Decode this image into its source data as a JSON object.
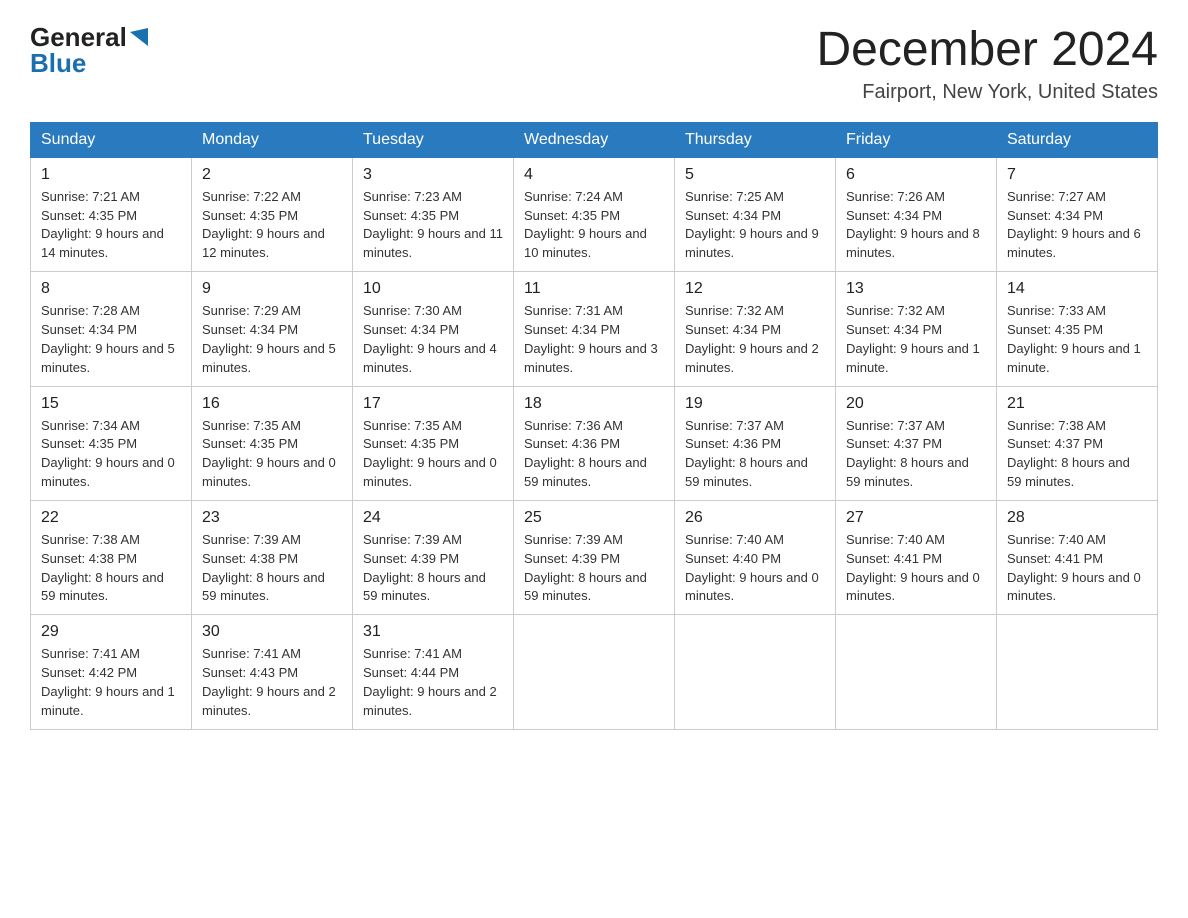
{
  "header": {
    "logo_general": "General",
    "logo_blue": "Blue",
    "month_title": "December 2024",
    "location": "Fairport, New York, United States"
  },
  "weekdays": [
    "Sunday",
    "Monday",
    "Tuesday",
    "Wednesday",
    "Thursday",
    "Friday",
    "Saturday"
  ],
  "weeks": [
    [
      {
        "day": "1",
        "sunrise": "7:21 AM",
        "sunset": "4:35 PM",
        "daylight": "9 hours and 14 minutes."
      },
      {
        "day": "2",
        "sunrise": "7:22 AM",
        "sunset": "4:35 PM",
        "daylight": "9 hours and 12 minutes."
      },
      {
        "day": "3",
        "sunrise": "7:23 AM",
        "sunset": "4:35 PM",
        "daylight": "9 hours and 11 minutes."
      },
      {
        "day": "4",
        "sunrise": "7:24 AM",
        "sunset": "4:35 PM",
        "daylight": "9 hours and 10 minutes."
      },
      {
        "day": "5",
        "sunrise": "7:25 AM",
        "sunset": "4:34 PM",
        "daylight": "9 hours and 9 minutes."
      },
      {
        "day": "6",
        "sunrise": "7:26 AM",
        "sunset": "4:34 PM",
        "daylight": "9 hours and 8 minutes."
      },
      {
        "day": "7",
        "sunrise": "7:27 AM",
        "sunset": "4:34 PM",
        "daylight": "9 hours and 6 minutes."
      }
    ],
    [
      {
        "day": "8",
        "sunrise": "7:28 AM",
        "sunset": "4:34 PM",
        "daylight": "9 hours and 5 minutes."
      },
      {
        "day": "9",
        "sunrise": "7:29 AM",
        "sunset": "4:34 PM",
        "daylight": "9 hours and 5 minutes."
      },
      {
        "day": "10",
        "sunrise": "7:30 AM",
        "sunset": "4:34 PM",
        "daylight": "9 hours and 4 minutes."
      },
      {
        "day": "11",
        "sunrise": "7:31 AM",
        "sunset": "4:34 PM",
        "daylight": "9 hours and 3 minutes."
      },
      {
        "day": "12",
        "sunrise": "7:32 AM",
        "sunset": "4:34 PM",
        "daylight": "9 hours and 2 minutes."
      },
      {
        "day": "13",
        "sunrise": "7:32 AM",
        "sunset": "4:34 PM",
        "daylight": "9 hours and 1 minute."
      },
      {
        "day": "14",
        "sunrise": "7:33 AM",
        "sunset": "4:35 PM",
        "daylight": "9 hours and 1 minute."
      }
    ],
    [
      {
        "day": "15",
        "sunrise": "7:34 AM",
        "sunset": "4:35 PM",
        "daylight": "9 hours and 0 minutes."
      },
      {
        "day": "16",
        "sunrise": "7:35 AM",
        "sunset": "4:35 PM",
        "daylight": "9 hours and 0 minutes."
      },
      {
        "day": "17",
        "sunrise": "7:35 AM",
        "sunset": "4:35 PM",
        "daylight": "9 hours and 0 minutes."
      },
      {
        "day": "18",
        "sunrise": "7:36 AM",
        "sunset": "4:36 PM",
        "daylight": "8 hours and 59 minutes."
      },
      {
        "day": "19",
        "sunrise": "7:37 AM",
        "sunset": "4:36 PM",
        "daylight": "8 hours and 59 minutes."
      },
      {
        "day": "20",
        "sunrise": "7:37 AM",
        "sunset": "4:37 PM",
        "daylight": "8 hours and 59 minutes."
      },
      {
        "day": "21",
        "sunrise": "7:38 AM",
        "sunset": "4:37 PM",
        "daylight": "8 hours and 59 minutes."
      }
    ],
    [
      {
        "day": "22",
        "sunrise": "7:38 AM",
        "sunset": "4:38 PM",
        "daylight": "8 hours and 59 minutes."
      },
      {
        "day": "23",
        "sunrise": "7:39 AM",
        "sunset": "4:38 PM",
        "daylight": "8 hours and 59 minutes."
      },
      {
        "day": "24",
        "sunrise": "7:39 AM",
        "sunset": "4:39 PM",
        "daylight": "8 hours and 59 minutes."
      },
      {
        "day": "25",
        "sunrise": "7:39 AM",
        "sunset": "4:39 PM",
        "daylight": "8 hours and 59 minutes."
      },
      {
        "day": "26",
        "sunrise": "7:40 AM",
        "sunset": "4:40 PM",
        "daylight": "9 hours and 0 minutes."
      },
      {
        "day": "27",
        "sunrise": "7:40 AM",
        "sunset": "4:41 PM",
        "daylight": "9 hours and 0 minutes."
      },
      {
        "day": "28",
        "sunrise": "7:40 AM",
        "sunset": "4:41 PM",
        "daylight": "9 hours and 0 minutes."
      }
    ],
    [
      {
        "day": "29",
        "sunrise": "7:41 AM",
        "sunset": "4:42 PM",
        "daylight": "9 hours and 1 minute."
      },
      {
        "day": "30",
        "sunrise": "7:41 AM",
        "sunset": "4:43 PM",
        "daylight": "9 hours and 2 minutes."
      },
      {
        "day": "31",
        "sunrise": "7:41 AM",
        "sunset": "4:44 PM",
        "daylight": "9 hours and 2 minutes."
      },
      null,
      null,
      null,
      null
    ]
  ],
  "labels": {
    "sunrise": "Sunrise:",
    "sunset": "Sunset:",
    "daylight": "Daylight:"
  }
}
